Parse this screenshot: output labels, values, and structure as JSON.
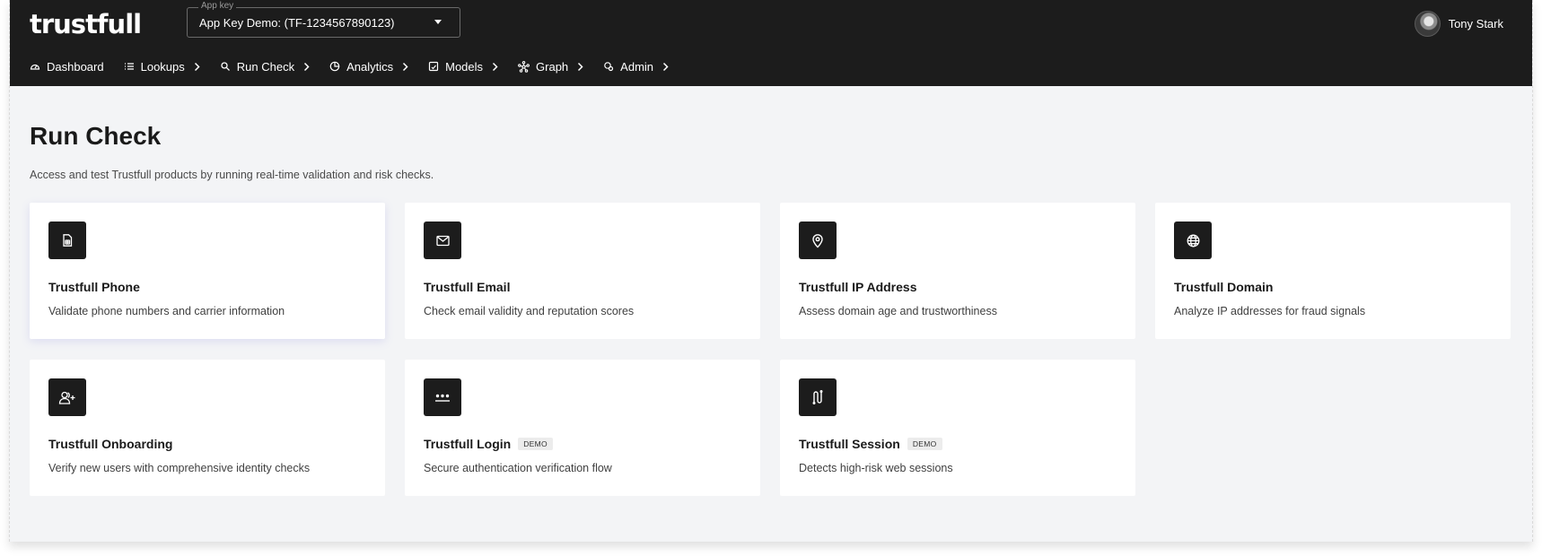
{
  "header": {
    "logo": "trustfull",
    "app_key": {
      "label": "App key",
      "value": "App Key Demo: (TF-1234567890123)"
    },
    "user": {
      "name": "Tony Stark"
    }
  },
  "nav": [
    {
      "label": "Dashboard",
      "icon": "gauge-icon",
      "has_submenu": false
    },
    {
      "label": "Lookups",
      "icon": "list-icon",
      "has_submenu": true
    },
    {
      "label": "Run Check",
      "icon": "search-icon",
      "has_submenu": true
    },
    {
      "label": "Analytics",
      "icon": "pie-chart-icon",
      "has_submenu": true
    },
    {
      "label": "Models",
      "icon": "model-icon",
      "has_submenu": true
    },
    {
      "label": "Graph",
      "icon": "graph-icon",
      "has_submenu": true
    },
    {
      "label": "Admin",
      "icon": "admin-icon",
      "has_submenu": true
    }
  ],
  "page": {
    "title": "Run Check",
    "subtitle": "Access and test Trustfull products by running real-time validation and risk checks."
  },
  "cards": [
    {
      "title": "Trustfull Phone",
      "description": "Validate phone numbers and carrier information",
      "icon": "sim-card-icon",
      "badge": ""
    },
    {
      "title": "Trustfull Email",
      "description": "Check email validity and reputation scores",
      "icon": "envelope-icon",
      "badge": ""
    },
    {
      "title": "Trustfull IP Address",
      "description": "Assess domain age and trustworthiness",
      "icon": "map-pin-icon",
      "badge": ""
    },
    {
      "title": "Trustfull Domain",
      "description": "Analyze IP addresses for fraud signals",
      "icon": "globe-icon",
      "badge": ""
    },
    {
      "title": "Trustfull Onboarding",
      "description": "Verify new users with comprehensive identity checks",
      "icon": "user-plus-icon",
      "badge": ""
    },
    {
      "title": "Trustfull Login",
      "description": "Secure authentication verification flow",
      "icon": "password-icon",
      "badge": "DEMO"
    },
    {
      "title": "Trustfull Session",
      "description": "Detects high-risk web sessions",
      "icon": "route-icon",
      "badge": "DEMO"
    }
  ],
  "colors": {
    "topbar": "#1c1c1c",
    "background": "#f3f4f6",
    "card": "#ffffff",
    "icon_tile": "#1c1c1c"
  }
}
